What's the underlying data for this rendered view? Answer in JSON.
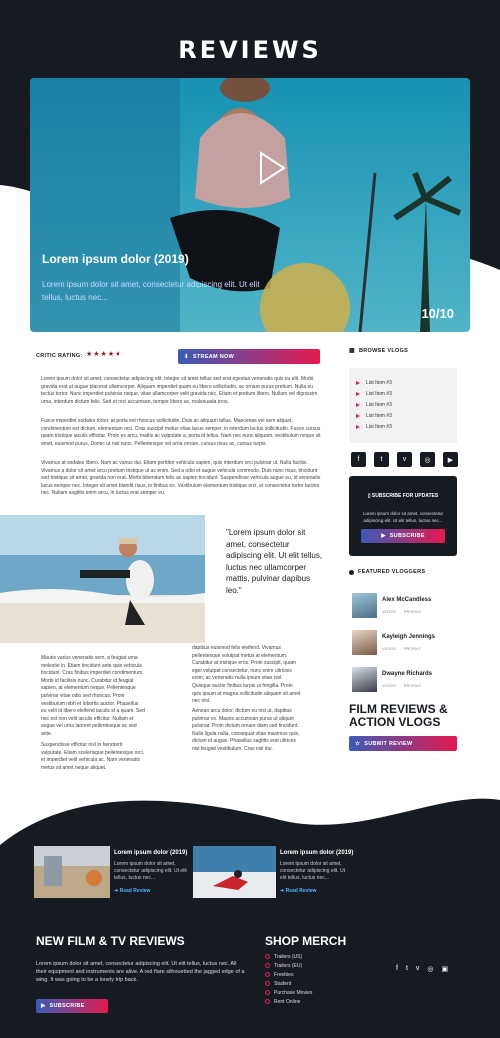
{
  "header": {
    "title": "REVIEWS"
  },
  "hero": {
    "title": "Lorem ipsum dolor (2019)",
    "desc": "Lorem ipsum dolor sit amet, consectetur adipiscing elit. Ut elit tellus, luctus nec...",
    "counter": "10/10"
  },
  "rating": {
    "label": "CRITIC RATING:",
    "stars": "★★★★",
    "half": "★",
    "value_stars": 4.5,
    "stream_label": "STREAM NOW"
  },
  "article": {
    "p1": "Lorem ipsum dolor sit amet, consectetur adipiscing elit. Integer sit amet tellus sed erat egestas venenatis quis eu elit. Morbi gravida erat ut augue placerat ullamcorper. Aliquam imperdiet quam eu libero sollicitudin, ac ornare purus pretium. Nulla eu tectus tortor. Nunc imperdiet pulvinar neque, vitae ullamcorper velit gravida nec. Etiam et pretium libero. Nullam vel dignissim urna, interdum dictum felis. Sed et orci accumsan, tempor libero ac, malesuada eros.",
    "p2": "Fusce imperdiet sodales tortor, at porta est rhoncus sollicitudin. Duis ac aliquam tellus. Maecenas vel sem aliquet, condimentum est dictum, elementum orci. Cras suscipit metus vitae lacus semper, in interdum lectus sollicitudin. Fusce cursus quam tristique iaculis efficitur. Proin ex arcu, mattis ac vulputate a, porta id tellus. Nam nec nunc aliquam, vestibulum neque sit amet, euismod purus. Donec ut nisl nunc. Pellentesque vel urna ornare, cursus risus ac, cursus turpis.",
    "p3": "Vivamus at sodales libero. Nam ac varius dui. Etiam porttitor vehicula sapien, quis interdum orci pulvinar ut. Nulla facilisi. Vivamus a dolor sit amet arcu pretium tristique ut ac enim. Sed a odio et augue vehicula commodo. Duis nunc risus, tincidunt sed tristique sit amet, gravida non erat. Morbi bibendum felis ac sapien tincidunt. Suspendisse vehicula augue eu, id venenatis lacus semper nec. Integer sit amet blandit risus, in finibus ex. Vestibulum elementum tristique orci, et consectetur tortor lacinia nec. Nullam sagittis enim arcu, in luctus erat semper eu.",
    "quote": "\"Lorem ipsum dolor sit amet, consectetur adipiscing elit. Ut elit tellus, luctus nec ullamcorper mattis, pulvinar dapibus leo.\"",
    "col1a": "Mauris varius venenatis sem, a feugiat urna molestie in. Etiam tincidunt ante quis vehicula tincidunt. Cras finibus imperdiet condimentum. Morbi id facilisis nunc. Curabitur id feugiat sapien, at elementum neque. Pellentesque pulvinar vitae odio sed rhoncus. Proin vestibulum nibh et lobortis auctor. Phasellus eu velit id libero eleifend iaculis id a quam. Sed nec est non velit iaculis efficitur. Nullam et augue vel urna laoreet pellentesque ac sed ante.",
    "col1b": "Suspendisse efficitur nisl in hendrerit vulputate. Etiam scelerisque pellentesque orci, et imperdiet velit vehicula ac. Nam venenatis metus sit amet neque aliquet.",
    "col2a": "dapibus euismod felis eleifend. Vivamus pellentesque volutpat metus at elementum. Curabitur at tristique eros. Proin suscipit, quam eget volutpat consectetur, nunc enim ultricies enim, ac venenatis nulla ipsum vitae nisl. Quisque auctor finibus turpis ut fringilla. Proin quis ipsum at magna sollicitudin aliquam sit amet nec nisl.",
    "col2b": "Aenean arcu dolor, dictum eu nisl ut, dapibus pulvinar ex. Mauris accumsan purus ut aliquet pulvinar. Proin dictum ornare diam sed tincidunt. Nulla ligula nulla, consequat vitae maximus quis, dictum id augue. Phasellus sagittis erat ultrices nisl feugiat vestibulum. Cras nisl dui."
  },
  "sidebar": {
    "browse_label": "BROWSE VLOGS",
    "items": [
      "List Item #3",
      "List Item #3",
      "List Item #3",
      "List Item #3",
      "List Item #3"
    ],
    "socials": [
      "f",
      "t",
      "v",
      "◎",
      "▶"
    ],
    "subscribe": {
      "title": "SUBSCRIBE FOR UPDATES",
      "desc": "Lorem ipsum dolor sit amet, consectetur adipiscing elit. Ut elit tellus, luctus nec...",
      "button": "SUBSCRIBE"
    },
    "featured_label": "FEATURED VLOGGERS",
    "vloggers": [
      {
        "name": "Alex McCandless",
        "vlogs": "VLOGS",
        "profile": "PROFILE"
      },
      {
        "name": "Kayleigh Jennings",
        "vlogs": "VLOGS",
        "profile": "PROFILE"
      },
      {
        "name": "Dwayne Richards",
        "vlogs": "VLOGS",
        "profile": "PROFILE"
      }
    ],
    "cta_title": "FILM REVIEWS & ACTION VLOGS",
    "cta_button": "SUBMIT REVIEW"
  },
  "cards": [
    {
      "title": "Lorem ipsum dolor (2019)",
      "desc": "Lorem ipsum dolor sit amet, consectetur adipiscing elit. Ut elit tellus, luctus nec...",
      "link": "Read Review"
    },
    {
      "title": "Lorem ipsum dolor (2019)",
      "desc": "Lorem ipsum dolor sit amet, consectetur adipiscing elit. Ut elit tellus, luctus nec...",
      "link": "Read Review"
    }
  ],
  "footer": {
    "heading": "NEW FILM & TV REVIEWS",
    "desc": "Lorem ipsum dolor sit amet, consectetur adipiscing elit. Ut elit tellus, luctus nec. All their equipment and instruments are alive. A red flare silhouetted the jagged edge of a wing. It was going to be a lonely trip back.",
    "button": "SUBSCRIBE",
    "merch_heading": "SHOP MERCH",
    "merch": [
      "Trailers (US)",
      "Trailers (EU)",
      "Freebies",
      "Student",
      "Purchase Movies",
      "Rent Online"
    ],
    "socials": [
      "f",
      "t",
      "v",
      "◎",
      "▣"
    ]
  },
  "colors": {
    "dark": "#161b22",
    "accent": "#e4194f",
    "blue": "#3b5bb8"
  }
}
